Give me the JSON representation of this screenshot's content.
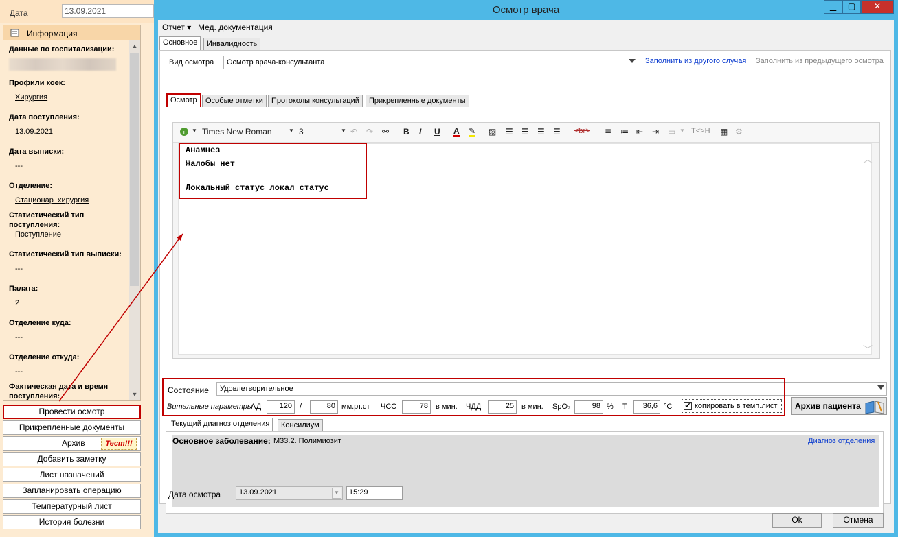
{
  "left": {
    "date_label": "Дата",
    "date_value": "13.09.2021",
    "info_title": "Информация",
    "fields": [
      {
        "label": "Данные по госпитализации:",
        "value": "",
        "link": false
      },
      {
        "label": "Профили коек:",
        "value": "Хирургия",
        "link": true
      },
      {
        "label": "Дата поступления:",
        "value": "13.09.2021",
        "link": false
      },
      {
        "label": "Дата выписки:",
        "value": "---",
        "link": false
      },
      {
        "label": "Отделение:",
        "value": "Стационар_хирургия",
        "link": true
      },
      {
        "label": "Статистический тип поступления:",
        "value": "Поступление",
        "link": false
      },
      {
        "label": "Статистический тип выписки:",
        "value": "---",
        "link": false
      },
      {
        "label": "Палата:",
        "value": "2",
        "link": false
      },
      {
        "label": "Отделение куда:",
        "value": "---",
        "link": false
      },
      {
        "label": "Отделение откуда:",
        "value": "---",
        "link": false
      },
      {
        "label": "Фактическая дата и время поступления:",
        "value": "",
        "link": false
      }
    ],
    "buttons": [
      "Провести осмотр",
      "Прикрепленные документы",
      "Архив",
      "Добавить заметку",
      "Лист назначений",
      "Запланировать операцию",
      "Температурный лист",
      "История болезни"
    ],
    "test_badge": "Тест!!!"
  },
  "dialog": {
    "title": "Осмотр врача",
    "menu": [
      "Отчет ▾",
      "Мед. документация"
    ],
    "top_tabs": [
      "Основное",
      "Инвалидность"
    ],
    "exam_type_label": "Вид осмотра",
    "exam_type_value": "Осмотр врача-консультанта",
    "fill_from_case": "Заполнить из другого случая",
    "fill_from_prev": "Заполнить из предыдущего осмотра",
    "inner_tabs": [
      "Осмотр",
      "Особые отметки",
      "Протоколы консультаций",
      "Прикрепленные документы"
    ],
    "editor": {
      "font_name": "Times New Roman",
      "font_size": "3",
      "tag_br": "<br>",
      "tag_tc": "T<>H",
      "lines": [
        "Анамнез",
        "Жалобы нет",
        "",
        "Локальный статус локал статус"
      ]
    },
    "state_label": "Состояние",
    "state_value": "Удовлетворительное",
    "vitals": {
      "label": "Витальные параметры",
      "ad_label": "АД",
      "ad_sys": "120",
      "sep": "/",
      "ad_dia": "80",
      "ad_unit": "мм.рт.ст",
      "chss_label": "ЧСС",
      "chss": "78",
      "chss_unit": "в мин.",
      "chdd_label": "ЧДД",
      "chdd": "25",
      "chdd_unit": "в мин.",
      "spo2_label": "SpO₂",
      "spo2": "98",
      "spo2_unit": "%",
      "t_label": "Т",
      "t": "36,6",
      "t_unit": "°C",
      "copy_label": "копировать в темп.лист"
    },
    "archive_button": "Архив пациента",
    "diag_tabs": [
      "Текущий диагноз отделения",
      "Консилиум"
    ],
    "diag_main_label": "Основное заболевание:",
    "diag_main_value": "M33.2. Полимиозит",
    "diag_link": "Диагноз отделения",
    "exam_date_label": "Дата осмотра",
    "exam_date": "13.09.2021",
    "exam_time": "15:29",
    "ok": "Ok",
    "cancel": "Отмена"
  },
  "colors": {
    "accent_red": "#c00000",
    "titlebar": "#4eb8e6",
    "left_bg": "#fdebd2",
    "link_blue": "#0b3ccf"
  }
}
